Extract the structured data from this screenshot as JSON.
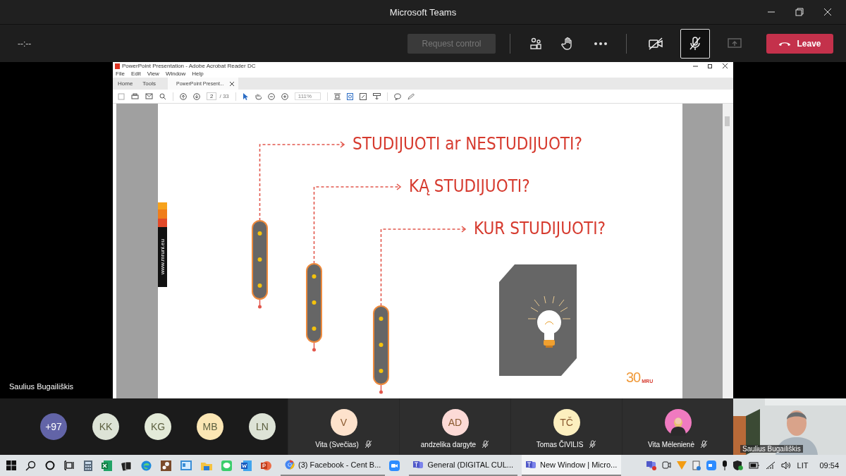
{
  "window": {
    "title": "Microsoft Teams"
  },
  "call_bar": {
    "timer": "--:--",
    "request_control": {
      "label": "Request control",
      "disabled": true
    },
    "camera_on": false,
    "mic_muted": true,
    "share_disabled": true,
    "leave": "Leave"
  },
  "shared_screen": {
    "presenter": "Saulius Bugailiškis",
    "app": {
      "title": "PowerPoint Presentation - Adobe Acrobat Reader DC",
      "menu": [
        "File",
        "Edit",
        "View",
        "Window",
        "Help"
      ],
      "tabs": [
        {
          "label": "Home",
          "selected": false
        },
        {
          "label": "Tools",
          "selected": false
        },
        {
          "label": "PowerPoint Present...",
          "selected": true
        }
      ],
      "page": "2",
      "page_total": "/ 33",
      "zoom": "111%",
      "slide": {
        "side_text": "www.mruni.eu",
        "questions": [
          "STUDIJUOTI ar NESTUDIJUOTI?",
          "KĄ STUDIJUOTI?",
          "KUR STUDIJUOTI?"
        ],
        "logo_number": "30",
        "logo_letters": "MRU"
      }
    }
  },
  "participants": {
    "overflow": "+97",
    "avatars": [
      {
        "initials": "KK",
        "color": "#dde3d6"
      },
      {
        "initials": "KG",
        "color": "#e3ead8"
      },
      {
        "initials": "MB",
        "color": "#fbe6b4"
      },
      {
        "initials": "LN",
        "color": "#dde3d6"
      }
    ],
    "tiles": [
      {
        "kind": "initials",
        "name": "Vita (Svečias)",
        "initials": "V",
        "color": "#fde2cc",
        "muted": true
      },
      {
        "kind": "initials",
        "name": "andzelika dargyte",
        "initials": "AD",
        "color": "#fcdad6",
        "muted": true
      },
      {
        "kind": "initials",
        "name": "Tomas ČIVILIS",
        "initials": "TČ",
        "color": "#fcefbf",
        "muted": true
      },
      {
        "kind": "picture",
        "name": "Vita Mėlenienė",
        "muted": true
      }
    ],
    "self_view": {
      "name": "Saulius Bugailiškis"
    }
  },
  "taskbar": {
    "windows": [
      {
        "kind": "browser",
        "label": "(3) Facebook - Cent B...",
        "selected": false
      },
      {
        "kind": "teams",
        "label": "General (DIGITAL CUL...",
        "selected": false
      },
      {
        "kind": "teams",
        "label": "New Window | Micro...",
        "selected": true
      }
    ],
    "language": "LIT",
    "time": "09:54"
  }
}
